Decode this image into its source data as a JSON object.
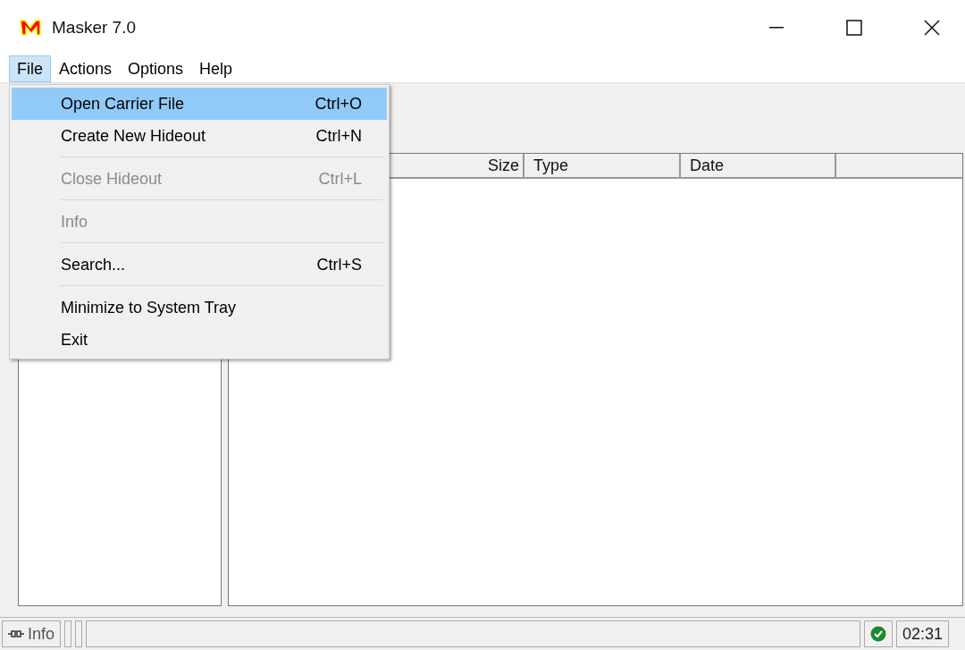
{
  "window": {
    "title": "Masker 7.0"
  },
  "menu_bar": [
    {
      "label": "File",
      "selected": true
    },
    {
      "label": "Actions",
      "selected": false
    },
    {
      "label": "Options",
      "selected": false
    },
    {
      "label": "Help",
      "selected": false
    }
  ],
  "file_menu": [
    {
      "kind": "item",
      "label": "Open Carrier File",
      "shortcut": "Ctrl+O",
      "selected": true,
      "disabled": false
    },
    {
      "kind": "item",
      "label": "Create New Hideout",
      "shortcut": "Ctrl+N",
      "selected": false,
      "disabled": false
    },
    {
      "kind": "separator"
    },
    {
      "kind": "item",
      "label": "Close Hideout",
      "shortcut": "Ctrl+L",
      "selected": false,
      "disabled": true
    },
    {
      "kind": "separator"
    },
    {
      "kind": "item",
      "label": "Info",
      "selected": false,
      "disabled": true
    },
    {
      "kind": "separator"
    },
    {
      "kind": "item",
      "label": "Search...",
      "shortcut": "Ctrl+S",
      "selected": false,
      "disabled": false
    },
    {
      "kind": "separator"
    },
    {
      "kind": "item",
      "label": "Minimize to System Tray",
      "selected": false,
      "disabled": false
    },
    {
      "kind": "item",
      "label": "Exit",
      "selected": false,
      "disabled": false
    }
  ],
  "file_list": {
    "columns": [
      "Size",
      "Type",
      "Date"
    ]
  },
  "status_bar": {
    "info": "Info",
    "time": "02:31"
  }
}
